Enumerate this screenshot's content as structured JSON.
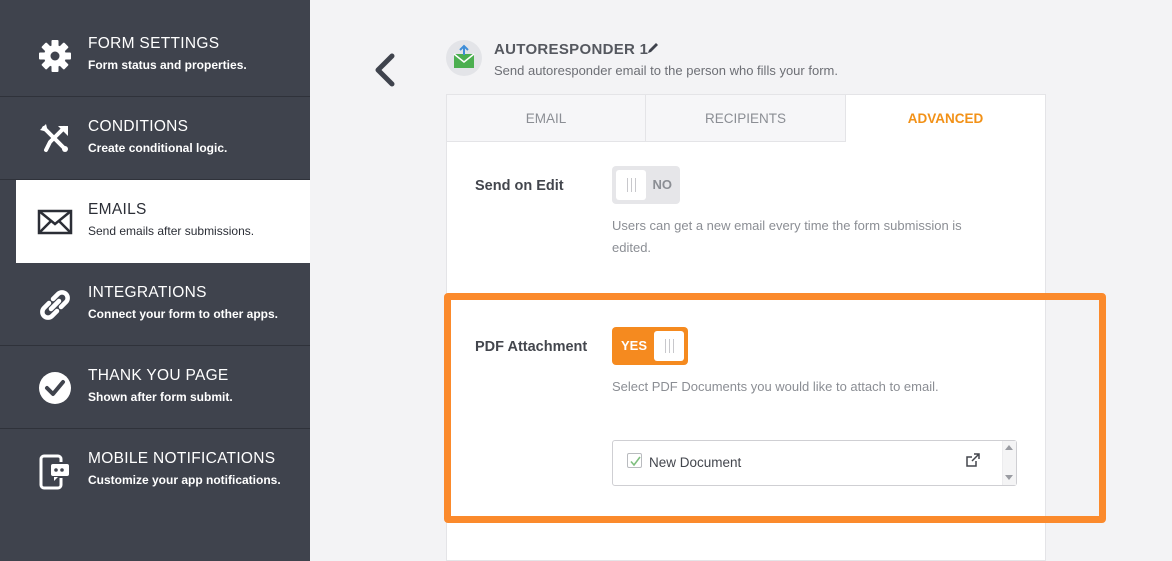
{
  "sidebar": {
    "items": [
      {
        "title": "FORM SETTINGS",
        "subtitle": "Form status and properties.",
        "icon": "gear-icon"
      },
      {
        "title": "CONDITIONS",
        "subtitle": "Create conditional logic.",
        "icon": "conditions-icon"
      },
      {
        "title": "EMAILS",
        "subtitle": "Send emails after submissions.",
        "icon": "envelope-icon"
      },
      {
        "title": "INTEGRATIONS",
        "subtitle": "Connect your form to other apps.",
        "icon": "link-icon"
      },
      {
        "title": "THANK YOU PAGE",
        "subtitle": "Shown after form submit.",
        "icon": "check-circle-icon"
      },
      {
        "title": "MOBILE NOTIFICATIONS",
        "subtitle": "Customize your app notifications.",
        "icon": "mobile-notification-icon"
      }
    ],
    "active_index": 2
  },
  "header": {
    "title": "AUTORESPONDER 1",
    "subtitle": "Send autoresponder email to the person who fills your form."
  },
  "tabs": [
    {
      "label": "EMAIL"
    },
    {
      "label": "RECIPIENTS"
    },
    {
      "label": "ADVANCED"
    }
  ],
  "active_tab": "ADVANCED",
  "settings": {
    "send_on_edit": {
      "label": "Send on Edit",
      "toggle_text": "NO",
      "value": false,
      "description_line1": "Users can get a new email every time the form submission is",
      "description_line2": "edited."
    },
    "pdf_attachment": {
      "label": "PDF Attachment",
      "toggle_text": "YES",
      "value": true,
      "description": "Select PDF Documents you would like to attach to email.",
      "documents": [
        {
          "name": "New Document",
          "checked": true
        }
      ]
    }
  },
  "colors": {
    "sidebar_bg": "#3f434d",
    "accent": "#f29117",
    "highlight": "#fb8a2c",
    "toggle_on": "#f58a1f"
  }
}
